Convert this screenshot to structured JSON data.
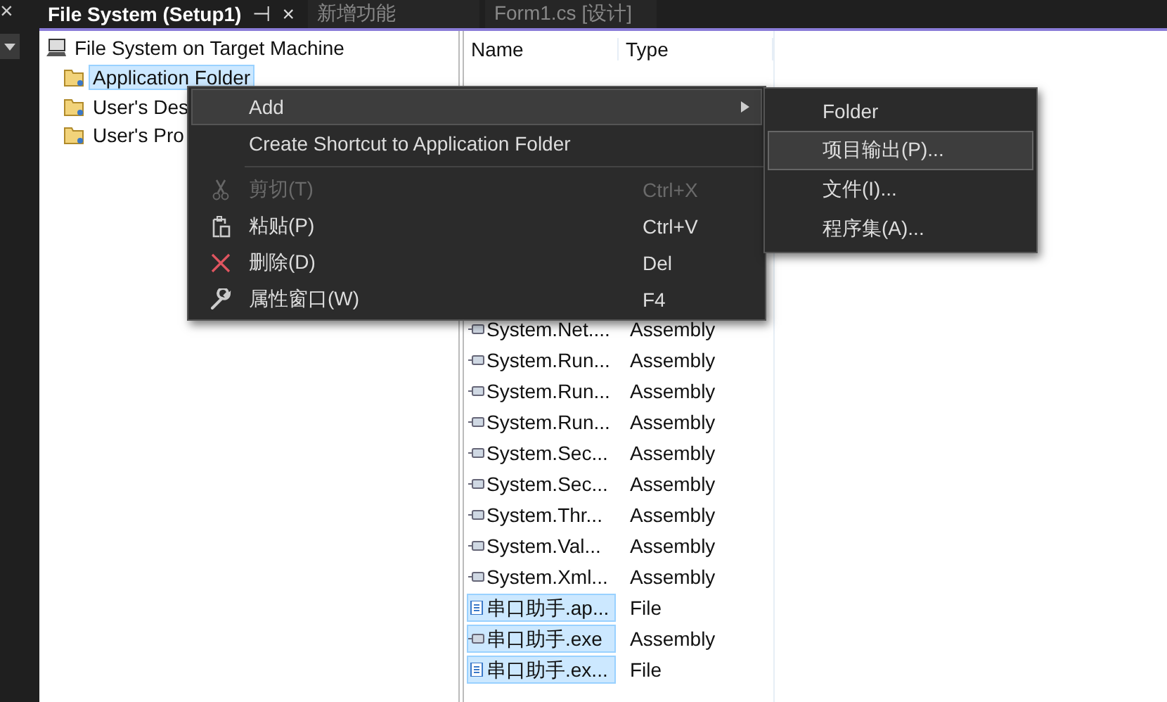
{
  "left_strip": {
    "close": "×"
  },
  "tabs": [
    {
      "label": "File System (Setup1)",
      "selected": true,
      "pin": "⊣",
      "close": "×"
    },
    {
      "label": "新增功能",
      "selected": false
    },
    {
      "label": "Form1.cs [设计]",
      "selected": false
    }
  ],
  "tree": {
    "root": "File System on Target Machine",
    "children": [
      {
        "label": "Application Folder",
        "selected": true
      },
      {
        "label": "User's Des",
        "selected": false
      },
      {
        "label": "User's Pro",
        "selected": false
      }
    ]
  },
  "list": {
    "columns": [
      "Name",
      "Type"
    ],
    "rows": [
      {
        "name": "System.Net....",
        "type": "Assembly",
        "kind": "assembly",
        "selected": false
      },
      {
        "name": "System.Run...",
        "type": "Assembly",
        "kind": "assembly",
        "selected": false
      },
      {
        "name": "System.Run...",
        "type": "Assembly",
        "kind": "assembly",
        "selected": false
      },
      {
        "name": "System.Run...",
        "type": "Assembly",
        "kind": "assembly",
        "selected": false
      },
      {
        "name": "System.Sec...",
        "type": "Assembly",
        "kind": "assembly",
        "selected": false
      },
      {
        "name": "System.Sec...",
        "type": "Assembly",
        "kind": "assembly",
        "selected": false
      },
      {
        "name": "System.Thr...",
        "type": "Assembly",
        "kind": "assembly",
        "selected": false
      },
      {
        "name": "System.Val...",
        "type": "Assembly",
        "kind": "assembly",
        "selected": false
      },
      {
        "name": "System.Xml...",
        "type": "Assembly",
        "kind": "assembly",
        "selected": false
      },
      {
        "name": "串口助手.ap...",
        "type": "File",
        "kind": "file",
        "selected": true
      },
      {
        "name": "串口助手.exe",
        "type": "Assembly",
        "kind": "assembly",
        "selected": true
      },
      {
        "name": "串口助手.ex...",
        "type": "File",
        "kind": "file",
        "selected": true
      }
    ]
  },
  "context_menu": {
    "items": [
      {
        "kind": "submenu",
        "label": "Add",
        "selected": true
      },
      {
        "kind": "item",
        "label": "Create Shortcut to Application Folder",
        "selected": false
      },
      {
        "kind": "separator"
      },
      {
        "kind": "cut",
        "label": "剪切(T)",
        "shortcut": "Ctrl+X",
        "disabled": true,
        "selected": false
      },
      {
        "kind": "paste",
        "label": "粘贴(P)",
        "shortcut": "Ctrl+V",
        "disabled": false,
        "selected": false
      },
      {
        "kind": "delete",
        "label": "删除(D)",
        "shortcut": "Del",
        "disabled": false,
        "selected": false
      },
      {
        "kind": "properties",
        "label": "属性窗口(W)",
        "shortcut": "F4",
        "disabled": false,
        "selected": false
      }
    ]
  },
  "submenu": {
    "items": [
      {
        "label": "Folder",
        "selected": false
      },
      {
        "label": "项目输出(P)...",
        "selected": true
      },
      {
        "label": "文件(I)...",
        "selected": false
      },
      {
        "label": "程序集(A)...",
        "selected": false
      }
    ]
  }
}
